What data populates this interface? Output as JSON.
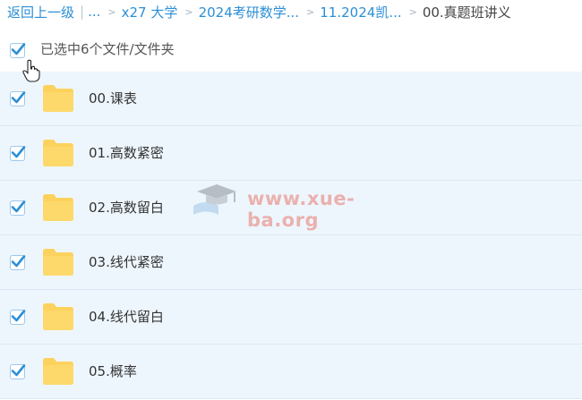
{
  "breadcrumb": {
    "back": "返回上一级",
    "separator": "|",
    "ellipsis": "...",
    "crumbs": [
      "x27 大学",
      "2024考研数学...",
      "11.2024凯..."
    ],
    "chevron": ">",
    "current": "00.真题班讲义"
  },
  "selection": {
    "checked": true,
    "text": "已选中6个文件/文件夹"
  },
  "items": [
    {
      "name": "00.课表",
      "checked": true,
      "type": "folder"
    },
    {
      "name": "01.高数紧密",
      "checked": true,
      "type": "folder"
    },
    {
      "name": "02.高数留白",
      "checked": true,
      "type": "folder"
    },
    {
      "name": "03.线代紧密",
      "checked": true,
      "type": "folder"
    },
    {
      "name": "04.线代留白",
      "checked": true,
      "type": "folder"
    },
    {
      "name": "05.概率",
      "checked": true,
      "type": "folder"
    }
  ],
  "watermark": {
    "text": "www.xue-ba.org"
  },
  "colors": {
    "accent": "#2b8fd6",
    "row_bg": "#eef6fd",
    "folder": "#fcd25e",
    "check": "#2b8fd6"
  },
  "icons": {
    "folder": "folder-icon",
    "check": "checkmark-icon",
    "cursor": "hand-pointer-icon"
  }
}
